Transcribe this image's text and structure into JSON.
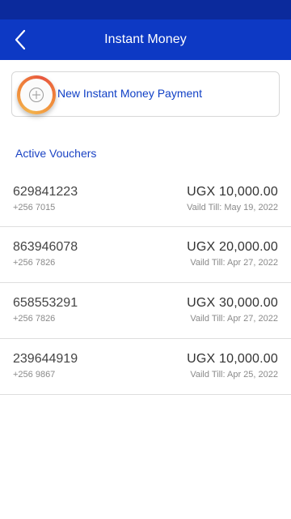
{
  "header": {
    "title": "Instant Money"
  },
  "new_payment": {
    "label": "New Instant Money Payment"
  },
  "section": {
    "title": "Active Vouchers"
  },
  "vouchers": [
    {
      "number": "629841223",
      "phone": "+256 7015",
      "amount": "UGX 10,000.00",
      "valid": "Vaild Till: May 19, 2022"
    },
    {
      "number": "863946078",
      "phone": "+256 7826",
      "amount": "UGX 20,000.00",
      "valid": "Vaild Till: Apr 27, 2022"
    },
    {
      "number": "658553291",
      "phone": "+256 7826",
      "amount": "UGX 30,000.00",
      "valid": "Vaild Till: Apr 27, 2022"
    },
    {
      "number": "239644919",
      "phone": "+256 9867",
      "amount": "UGX 10,000.00",
      "valid": "Vaild Till: Apr 25, 2022"
    }
  ],
  "colors": {
    "app_bar": "#0d39c4",
    "status_bar": "#0b2a9c",
    "accent_text": "#1040c6"
  },
  "icons": {
    "back": "chevron-left-icon",
    "add": "plus-circle-icon"
  }
}
